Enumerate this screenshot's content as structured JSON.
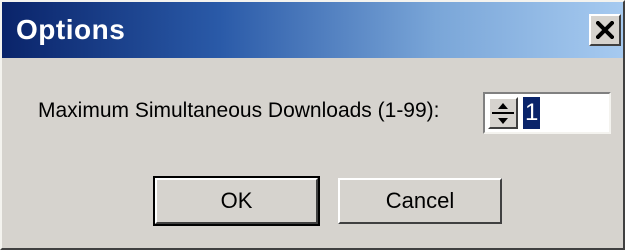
{
  "window": {
    "title": "Options",
    "close_icon": "close-x-icon"
  },
  "form": {
    "max_downloads_label": "Maximum Simultaneous Downloads (1-99):",
    "max_downloads_value": "1",
    "spinner_up_icon": "spin-up-arrow-icon",
    "spinner_down_icon": "spin-down-arrow-icon"
  },
  "buttons": {
    "ok_label": "OK",
    "cancel_label": "Cancel"
  },
  "colors": {
    "titlebar_start": "#0a246a",
    "titlebar_end": "#a6caf0",
    "dialog_face": "#d6d3ce",
    "selection": "#0a246a"
  }
}
